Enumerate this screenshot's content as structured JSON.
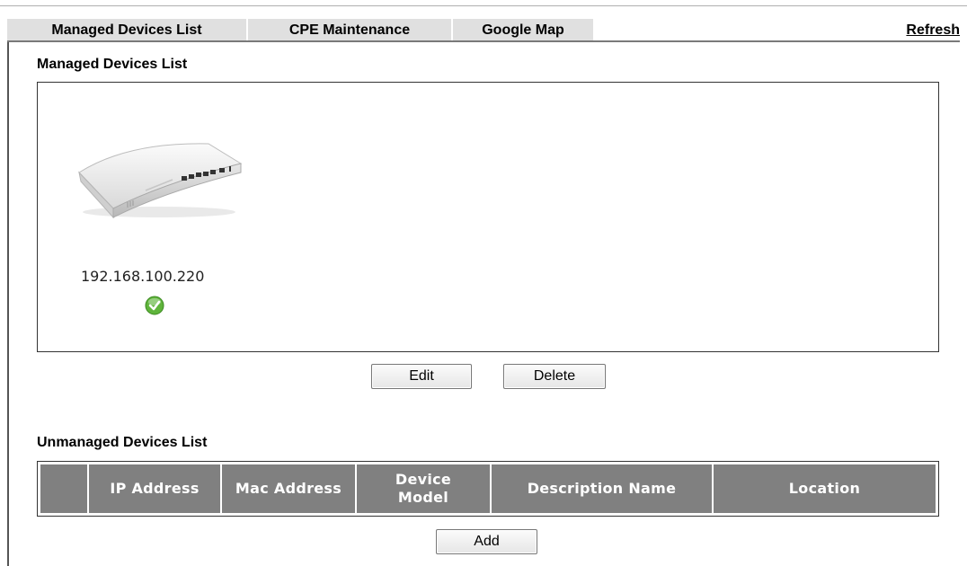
{
  "tabs": [
    {
      "label": "Managed Devices List"
    },
    {
      "label": "CPE Maintenance"
    },
    {
      "label": "Google Map"
    }
  ],
  "refresh_label": "Refresh",
  "managed": {
    "title": "Managed Devices List",
    "devices": [
      {
        "ip": "192.168.100.220",
        "status": "online",
        "status_icon": "check-circle-icon",
        "image": "router-icon"
      }
    ]
  },
  "buttons": {
    "edit": "Edit",
    "delete": "Delete",
    "add": "Add"
  },
  "unmanaged": {
    "title": "Unmanaged Devices List",
    "columns": [
      "",
      "IP Address",
      "Mac Address",
      "Device Model",
      "Description Name",
      "Location"
    ]
  },
  "colors": {
    "tab_bg": "#e0e0e0",
    "header_bg": "#808080",
    "status_ok": "#5fb43b"
  }
}
